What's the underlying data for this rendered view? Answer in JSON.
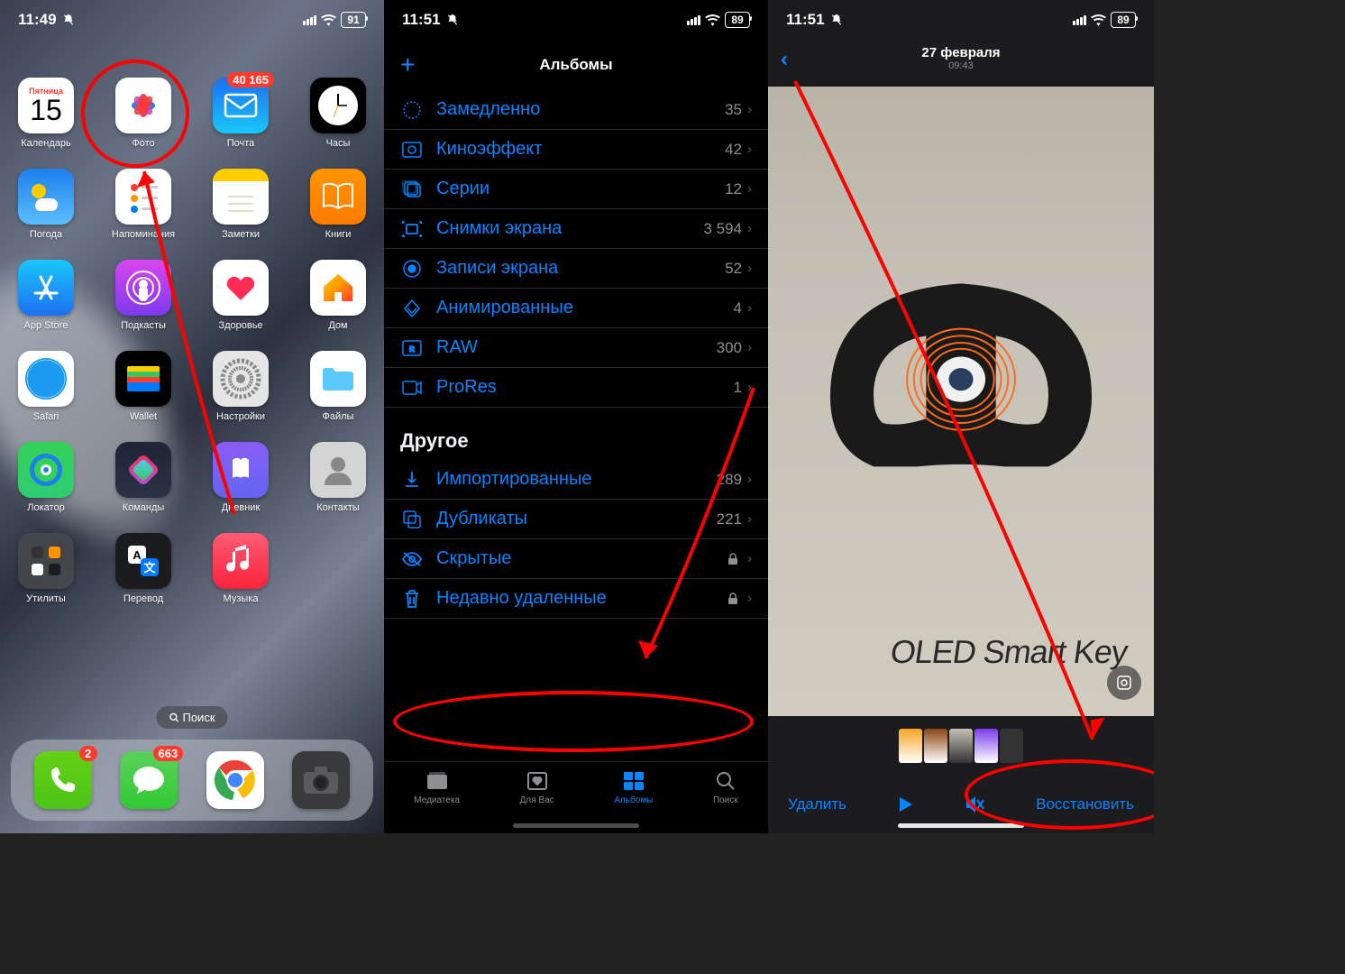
{
  "p1": {
    "status": {
      "time": "11:49",
      "battery": "91"
    },
    "apps_r1": [
      {
        "label": "Календарь",
        "day": "Пятница",
        "date": "15"
      },
      {
        "label": "Фото"
      },
      {
        "label": "Почта",
        "badge": "40 165"
      },
      {
        "label": "Часы"
      }
    ],
    "apps_r2": [
      {
        "label": "Погода"
      },
      {
        "label": "Напоминания"
      },
      {
        "label": "Заметки"
      },
      {
        "label": "Книги"
      }
    ],
    "apps_r3": [
      {
        "label": "App Store"
      },
      {
        "label": "Подкасты"
      },
      {
        "label": "Здоровье"
      },
      {
        "label": "Дом"
      }
    ],
    "apps_r4": [
      {
        "label": "Safari"
      },
      {
        "label": "Wallet"
      },
      {
        "label": "Настройки"
      },
      {
        "label": "Файлы"
      }
    ],
    "apps_r5": [
      {
        "label": "Локатор"
      },
      {
        "label": "Команды"
      },
      {
        "label": "Дневник"
      },
      {
        "label": "Контакты"
      }
    ],
    "apps_r6": [
      {
        "label": "Утилиты"
      },
      {
        "label": "Перевод"
      },
      {
        "label": "Музыка"
      }
    ],
    "search": "Поиск",
    "dock_badges": {
      "phone": "2",
      "messages": "663"
    }
  },
  "p2": {
    "status": {
      "time": "11:51",
      "battery": "89"
    },
    "header": "Альбомы",
    "media_types": [
      {
        "icon": "slowmo",
        "label": "Замедленно",
        "count": "35"
      },
      {
        "icon": "cinematic",
        "label": "Киноэффект",
        "count": "42"
      },
      {
        "icon": "burst",
        "label": "Серии",
        "count": "12"
      },
      {
        "icon": "screenshot",
        "label": "Снимки экрана",
        "count": "3 594"
      },
      {
        "icon": "screenrec",
        "label": "Записи экрана",
        "count": "52"
      },
      {
        "icon": "animated",
        "label": "Анимированные",
        "count": "4"
      },
      {
        "icon": "raw",
        "label": "RAW",
        "count": "300"
      },
      {
        "icon": "prores",
        "label": "ProRes",
        "count": "1"
      }
    ],
    "section_other": "Другое",
    "other": [
      {
        "icon": "import",
        "label": "Импортированные",
        "count": "289"
      },
      {
        "icon": "duplicate",
        "label": "Дубликаты",
        "count": "221"
      },
      {
        "icon": "hidden",
        "label": "Скрытые",
        "lock": true
      },
      {
        "icon": "trash",
        "label": "Недавно удаленные",
        "lock": true
      }
    ],
    "tabs": [
      {
        "label": "Медиатека"
      },
      {
        "label": "Для Вас"
      },
      {
        "label": "Альбомы"
      },
      {
        "label": "Поиск"
      }
    ]
  },
  "p3": {
    "status": {
      "time": "11:51",
      "battery": "89"
    },
    "date": "27 февраля",
    "time": "09:43",
    "photo_text": "OLED Smart Key",
    "toolbar": {
      "delete": "Удалить",
      "restore": "Восстановить"
    }
  }
}
